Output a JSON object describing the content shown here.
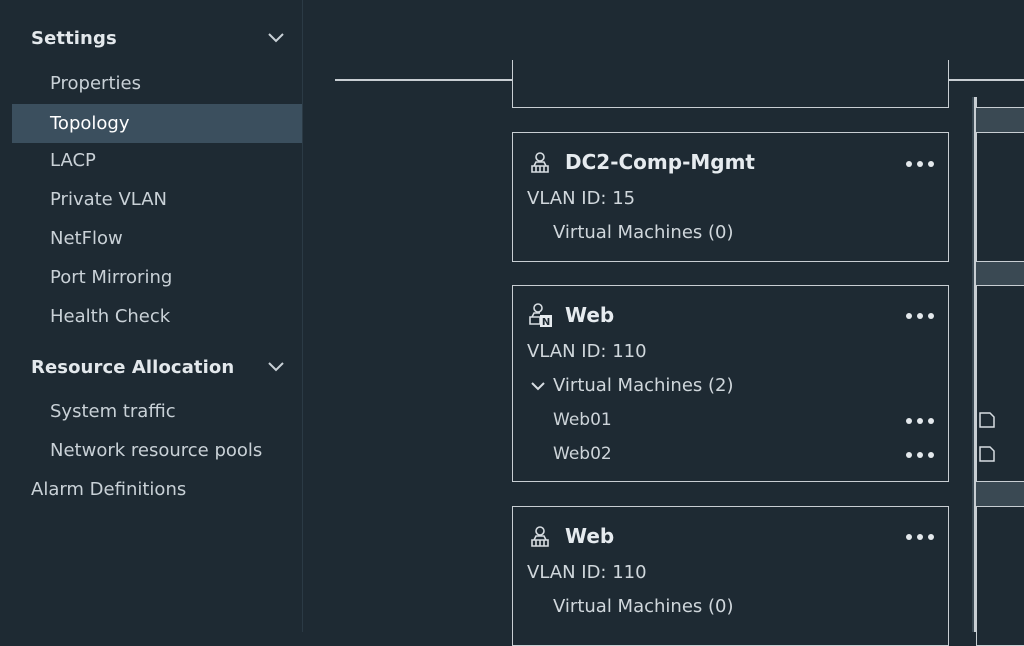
{
  "sidebar": {
    "settings": {
      "label": "Settings"
    },
    "settings_items": [
      {
        "label": "Properties"
      },
      {
        "label": "Topology"
      },
      {
        "label": "LACP"
      },
      {
        "label": "Private VLAN"
      },
      {
        "label": "NetFlow"
      },
      {
        "label": "Port Mirroring"
      },
      {
        "label": "Health Check"
      }
    ],
    "resource": {
      "label": "Resource Allocation"
    },
    "resource_items": [
      {
        "label": "System traffic"
      },
      {
        "label": "Network resource pools"
      }
    ],
    "alarm": {
      "label": "Alarm Definitions"
    },
    "active_item": "Topology"
  },
  "portgroups": [
    {
      "name": "DC2-Comp-Mgmt",
      "icon": "portgroup-icon",
      "vlan": "VLAN ID: 15",
      "vms_label": "Virtual Machines (0)"
    },
    {
      "name": "Web",
      "icon": "nsx-portgroup-icon",
      "vlan": "VLAN ID: 110",
      "vms_label": "Virtual Machines (2)",
      "vms": [
        {
          "name": "Web01"
        },
        {
          "name": "Web02"
        }
      ]
    },
    {
      "name": "Web",
      "icon": "portgroup-icon",
      "vlan": "VLAN ID: 110",
      "vms_label": "Virtual Machines (0)"
    }
  ],
  "colors": {
    "background": "#1e2a33",
    "active_nav": "#3b4f5e",
    "border": "#c8ced3",
    "uplink_column": "#3a4953"
  }
}
